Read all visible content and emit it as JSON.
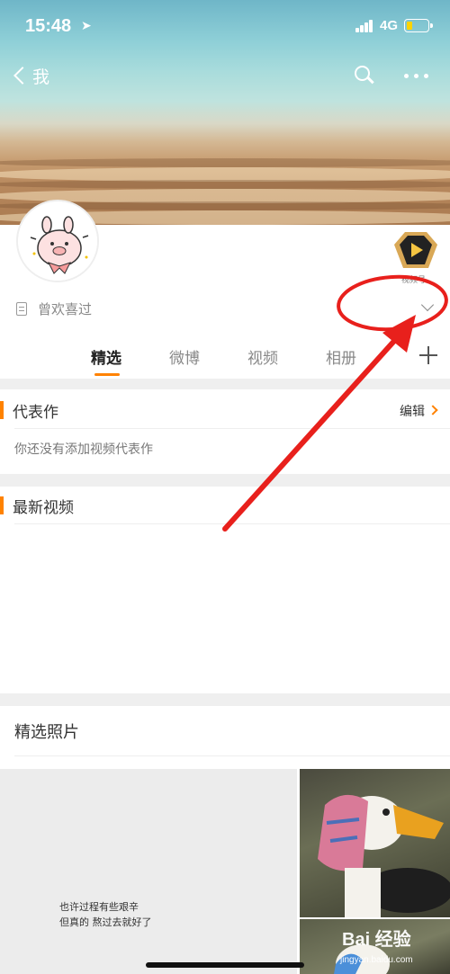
{
  "status_bar": {
    "time": "15:48",
    "network": "4G"
  },
  "nav": {
    "back_label": "我"
  },
  "profile": {
    "video_badge_label": "视频号",
    "intro": "曾欢喜过"
  },
  "tabs": [
    {
      "label": "精选",
      "active": true
    },
    {
      "label": "微博",
      "active": false
    },
    {
      "label": "视频",
      "active": false
    },
    {
      "label": "相册",
      "active": false
    }
  ],
  "sections": {
    "representative": {
      "title": "代表作",
      "edit_label": "编辑",
      "empty_text": "你还没有添加视频代表作"
    },
    "latest_video": {
      "title": "最新视频"
    },
    "featured_photos": {
      "title": "精选照片",
      "photo_caption_line1": "也许过程有些艰辛",
      "photo_caption_line2": "但真的 熬过去就好了"
    }
  },
  "watermark": {
    "main": "Bai 经验",
    "sub": "jingyan.baidu.com"
  },
  "colors": {
    "accent": "#ff8200",
    "annotation": "#e8201c"
  },
  "icons": [
    "location-arrow-icon",
    "signal-icon",
    "battery-icon",
    "back-chevron-icon",
    "search-icon",
    "more-icon",
    "doc-icon",
    "expand-chevron-icon",
    "plus-icon",
    "edit-chevron-icon",
    "video-badge-icon"
  ]
}
